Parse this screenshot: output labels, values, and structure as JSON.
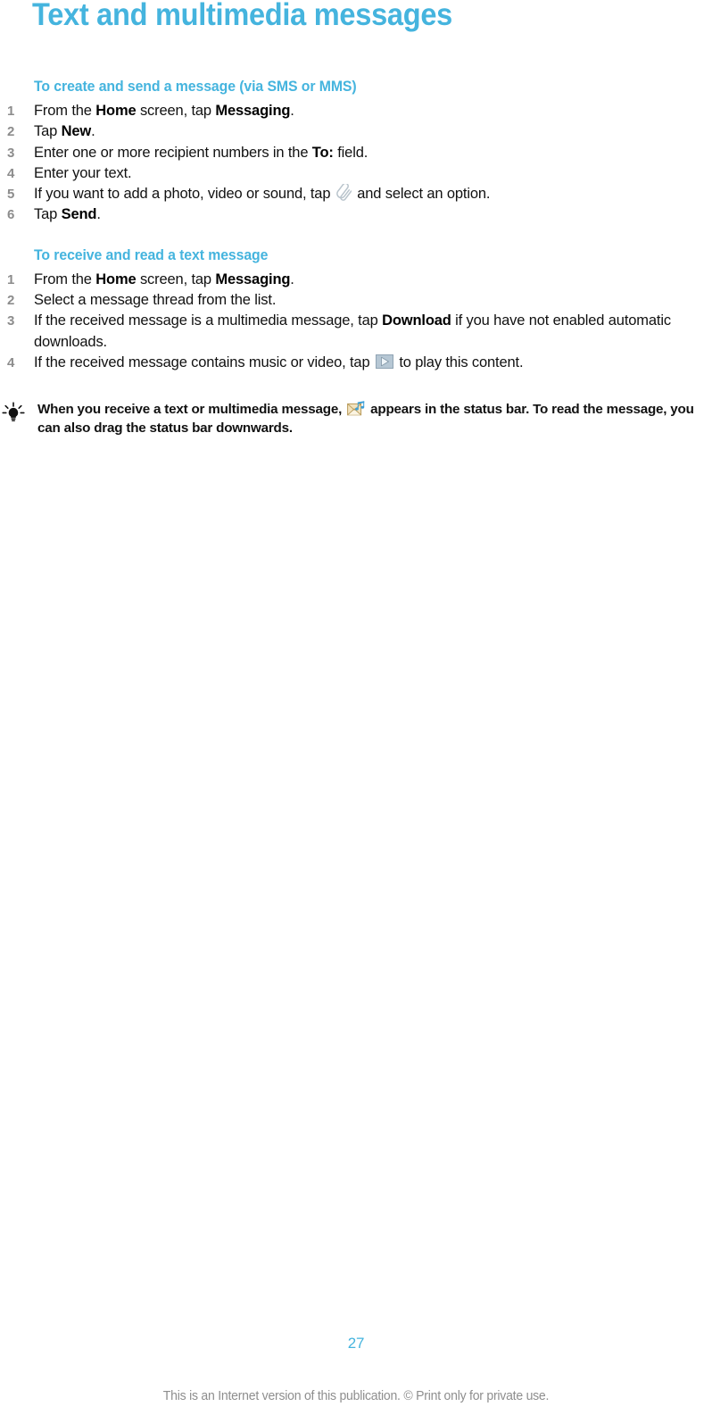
{
  "document": {
    "title": "Text and multimedia messages",
    "accent_color": "#45b4de",
    "number_color": "#8c8c8c",
    "body_color": "#111111",
    "footer_color": "#8e8e8e"
  },
  "sections": [
    {
      "heading": "To create and send a message (via SMS or MMS)",
      "steps": [
        {
          "number": "1",
          "parts": [
            {
              "t": "From the ",
              "b": false
            },
            {
              "t": "Home",
              "b": true
            },
            {
              "t": " screen, tap ",
              "b": false
            },
            {
              "t": "Messaging",
              "b": true
            },
            {
              "t": ".",
              "b": false
            }
          ]
        },
        {
          "number": "2",
          "parts": [
            {
              "t": "Tap ",
              "b": false
            },
            {
              "t": "New",
              "b": true
            },
            {
              "t": ".",
              "b": false
            }
          ]
        },
        {
          "number": "3",
          "parts": [
            {
              "t": "Enter one or more recipient numbers in the ",
              "b": false
            },
            {
              "t": "To:",
              "b": true
            },
            {
              "t": " field.",
              "b": false
            }
          ]
        },
        {
          "number": "4",
          "parts": [
            {
              "t": "Enter your text.",
              "b": false
            }
          ]
        },
        {
          "number": "5",
          "parts": [
            {
              "t": "If you want to add a photo, video or sound, tap ",
              "b": false
            },
            {
              "icon": "paperclip-icon"
            },
            {
              "t": " and select an option.",
              "b": false
            }
          ]
        },
        {
          "number": "6",
          "parts": [
            {
              "t": "Tap ",
              "b": false
            },
            {
              "t": "Send",
              "b": true
            },
            {
              "t": ".",
              "b": false
            }
          ]
        }
      ]
    },
    {
      "heading": "To receive and read a text message",
      "steps": [
        {
          "number": "1",
          "parts": [
            {
              "t": "From the ",
              "b": false
            },
            {
              "t": "Home",
              "b": true
            },
            {
              "t": " screen, tap ",
              "b": false
            },
            {
              "t": "Messaging",
              "b": true
            },
            {
              "t": ".",
              "b": false
            }
          ]
        },
        {
          "number": "2",
          "parts": [
            {
              "t": "Select a message thread from the list.",
              "b": false
            }
          ]
        },
        {
          "number": "3",
          "wrap": true,
          "parts": [
            {
              "t": "If the received message is a multimedia message, tap ",
              "b": false
            },
            {
              "t": "Download",
              "b": true
            },
            {
              "t": " if you have not enabled automatic downloads.",
              "b": false
            }
          ]
        },
        {
          "number": "4",
          "parts": [
            {
              "t": "If the received message contains music or video, tap ",
              "b": false
            },
            {
              "icon": "play-icon"
            },
            {
              "t": " to play this content.",
              "b": false
            }
          ]
        }
      ]
    }
  ],
  "tip": {
    "icon": "lightbulb-tip-icon",
    "parts": [
      {
        "t": "When you receive a text or multimedia message, ",
        "b": true
      },
      {
        "icon": "multimedia-message-icon"
      },
      {
        "t": " appears in the status bar. To read the message, you can also drag the status bar downwards.",
        "b": true
      }
    ]
  },
  "footer": {
    "page_number": "27",
    "note": "This is an Internet version of this publication. © Print only for private use."
  }
}
